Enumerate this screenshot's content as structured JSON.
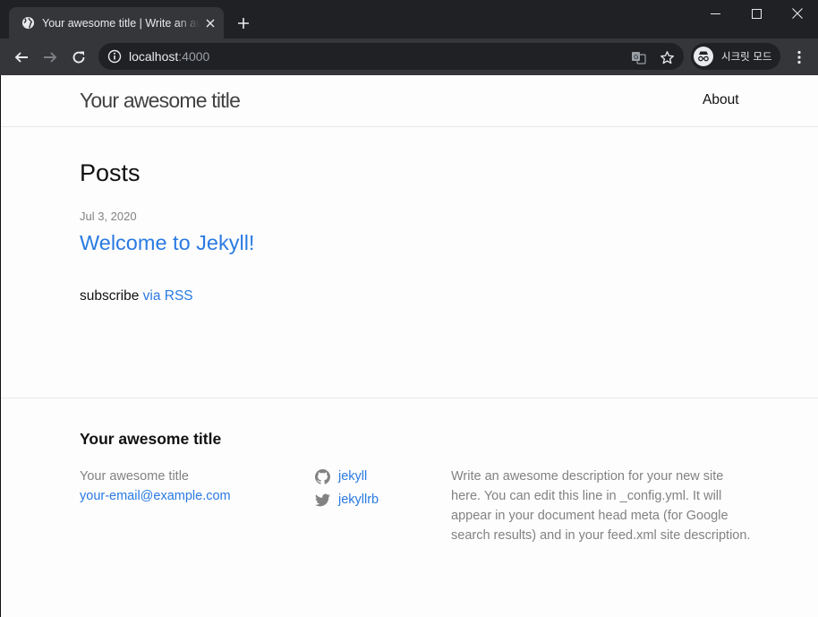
{
  "browser": {
    "tab_title": "Your awesome title | Write an awesome description",
    "url_host": "localhost",
    "url_port": ":4000",
    "incognito_label": "시크릿 모드"
  },
  "header": {
    "site_title": "Your awesome title",
    "nav": [
      "About"
    ]
  },
  "main": {
    "heading": "Posts",
    "posts": [
      {
        "date": "Jul 3, 2020",
        "title": "Welcome to Jekyll!"
      }
    ],
    "subscribe_text": "subscribe ",
    "subscribe_link": "via RSS"
  },
  "footer": {
    "heading": "Your awesome title",
    "name": "Your awesome title",
    "email": "your-email@example.com",
    "social": [
      {
        "icon": "github-icon",
        "label": "jekyll"
      },
      {
        "icon": "twitter-icon",
        "label": "jekyllrb"
      }
    ],
    "description": "Write an awesome description for your new site here. You can edit this line in _config.yml. It will appear in your document head meta (for Google search results) and in your feed.xml site description."
  },
  "colors": {
    "link": "#2a7ae2",
    "muted": "#828282",
    "text": "#111111",
    "chrome_dark": "#202124",
    "chrome_toolbar": "#35363a"
  }
}
